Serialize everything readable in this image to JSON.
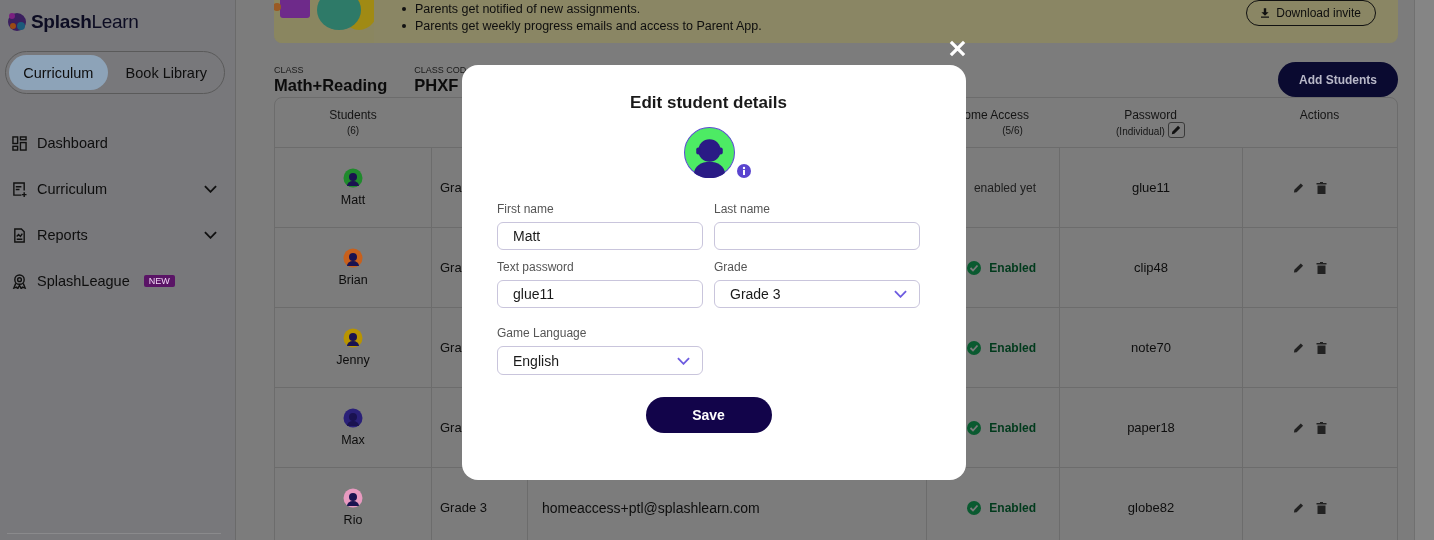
{
  "sidebar": {
    "logo": "**Splash**Learn",
    "toggle": [
      {
        "label": "Curriculum",
        "selected": true
      },
      {
        "label": "Book Library",
        "selected": false
      }
    ],
    "nav": [
      {
        "label": "Dashboard",
        "has_submenu": false
      },
      {
        "label": "Curriculum",
        "has_submenu": true
      },
      {
        "label": "Reports",
        "has_submenu": true
      },
      {
        "label": "SplashLeague",
        "has_submenu": false,
        "badge": "NEW"
      }
    ]
  },
  "banner": {
    "bullets": [
      "Parents get notified of new assignments.",
      "Parents get weekly progress emails and access to Parent App."
    ],
    "download_button": "Download invite"
  },
  "class_info": [
    {
      "label": "CLASS",
      "value": "Math+Reading"
    },
    {
      "label": "CLASS COD",
      "value": "PHXF"
    }
  ],
  "add_students_button": "Add Students",
  "table": {
    "header": {
      "students": {
        "title": "Students",
        "sub": "(6)"
      },
      "home_access": {
        "title": "ome Access",
        "sub": "(5/6)"
      },
      "password": {
        "title": "Password",
        "sub": "(Individual)"
      },
      "actions": {
        "title": "Actions"
      }
    },
    "rows": [
      {
        "name": "Matt",
        "color": "#1f8a2c",
        "grade": "Gra",
        "home_access": {
          "text": "enabled yet",
          "enabled": false
        },
        "password": "glue11"
      },
      {
        "name": "Brian",
        "color": "#c8601c",
        "grade": "Gra",
        "home_access": {
          "text": "Enabled",
          "enabled": true
        },
        "password": "clip48"
      },
      {
        "name": "Jenny",
        "color": "#b89400",
        "grade": "Gra",
        "home_access": {
          "text": "Enabled",
          "enabled": true
        },
        "password": "note70"
      },
      {
        "name": "Max",
        "color": "#2a2078",
        "grade": "Gra",
        "home_access": {
          "text": "Enabled",
          "enabled": true
        },
        "password": "paper18"
      },
      {
        "name": "Rio",
        "color": "#e89ac0",
        "grade": "Grade 3",
        "email": "homeaccess+ptl@splashlearn.com",
        "home_access": {
          "text": "Enabled",
          "enabled": true
        },
        "password": "globe82"
      }
    ]
  },
  "modal": {
    "title": "Edit student details",
    "fields": [
      {
        "label": "First name",
        "kind": "text",
        "value": "Matt"
      },
      {
        "label": "Last name",
        "kind": "text"
      },
      {
        "label": "Text password",
        "kind": "text",
        "value": "glue11"
      },
      {
        "label": "Grade",
        "kind": "select",
        "value": "Grade 3"
      },
      {
        "label": "Game Language",
        "kind": "select",
        "value": "English"
      }
    ],
    "save_button": "Save"
  }
}
